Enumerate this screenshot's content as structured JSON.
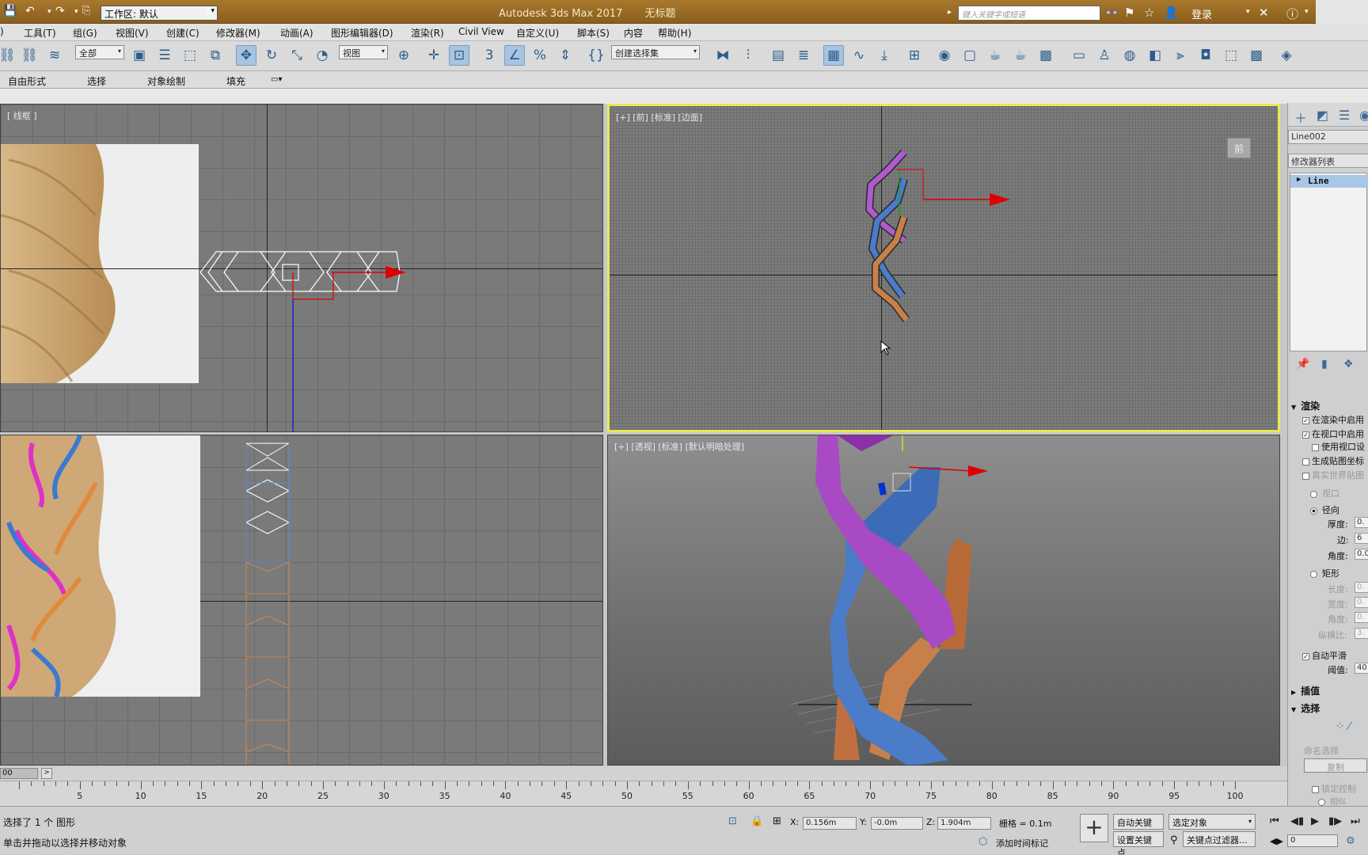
{
  "titlebar": {
    "workspace_label": "工作区: 默认",
    "app_title": "Autodesk 3ds Max 2017",
    "doc_title": "无标题",
    "search_placeholder": "键入关键字或短语",
    "login": "登录"
  },
  "menu": {
    "items": [
      ")",
      "工具(T)",
      "组(G)",
      "视图(V)",
      "创建(C)",
      "修改器(M)",
      "动画(A)",
      "图形编辑器(D)",
      "渲染(R)",
      "Civil View",
      "自定义(U)",
      "脚本(S)",
      "内容",
      "帮助(H)"
    ]
  },
  "toolbar": {
    "filter": "全部",
    "ref_coord": "视图",
    "selection_set": "创建选择集"
  },
  "ribbon": {
    "tabs": [
      "自由形式",
      "选择",
      "对象绘制",
      "填充"
    ]
  },
  "viewports": {
    "top_left_label": "[ 线框 ]",
    "top_right_label": "[+] [前] [标准] [边面]",
    "bottom_right_label": "[+] [透视] [标准] [默认明暗处理]",
    "viewcube_label": "前"
  },
  "command_panel": {
    "object_name": "Line002",
    "modifier_list": "修改器列表",
    "modifier_item": "Line",
    "rollout_render": "渲染",
    "enable_in_render": "在渲染中启用",
    "enable_in_viewport": "在视口中启用",
    "use_viewport_settings": "使用视口设",
    "gen_mapping_coords": "生成贴图坐标",
    "real_world_map": "真实世界贴图",
    "viewport": "视口",
    "radial": "径向",
    "thickness_label": "厚度:",
    "thickness_val": "0.",
    "sides_label": "边:",
    "sides_val": "6",
    "angle_label": "角度:",
    "angle_val": "0.0",
    "rectangular": "矩形",
    "length_label": "长度:",
    "length_val": "0.",
    "width_label": "宽度:",
    "width_val": "0.",
    "angle2_label": "角度:",
    "angle2_val": "0.",
    "aspect_label": "纵横比:",
    "aspect_val": "3.",
    "auto_smooth": "自动平滑",
    "threshold_label": "阈值:",
    "threshold_val": "40",
    "rollout_interp": "插值",
    "rollout_select": "选择",
    "named_sel": "命名选择",
    "copy": "复制",
    "lock_handles": "锁定控制",
    "similar": "相似"
  },
  "timeline": {
    "slider": "00",
    "ticks": [
      5,
      10,
      15,
      20,
      25,
      30,
      35,
      40,
      45,
      50,
      55,
      60,
      65,
      70,
      75,
      80,
      85,
      90,
      95,
      100
    ]
  },
  "status": {
    "selection": "选择了 1 个 图形",
    "prompt": "单击并拖动以选择并移动对象",
    "x_label": "X:",
    "x_val": "0.156m",
    "y_label": "Y:",
    "y_val": "-0.0m",
    "z_label": "Z:",
    "z_val": "1.904m",
    "grid": "栅格 = 0.1m",
    "add_time_tag": "添加时间标记",
    "auto_key": "自动关键点",
    "set_key": "设置关键点",
    "selected_obj": "选定对象",
    "key_filters": "关键点过滤器...",
    "frame": "0"
  },
  "colors": {
    "titlebar": "#9a6b24",
    "viewport_active_border": "#e8e85a",
    "strand_purple": "#a84ac4",
    "strand_blue": "#4a7cc8",
    "strand_orange": "#c8804a"
  }
}
